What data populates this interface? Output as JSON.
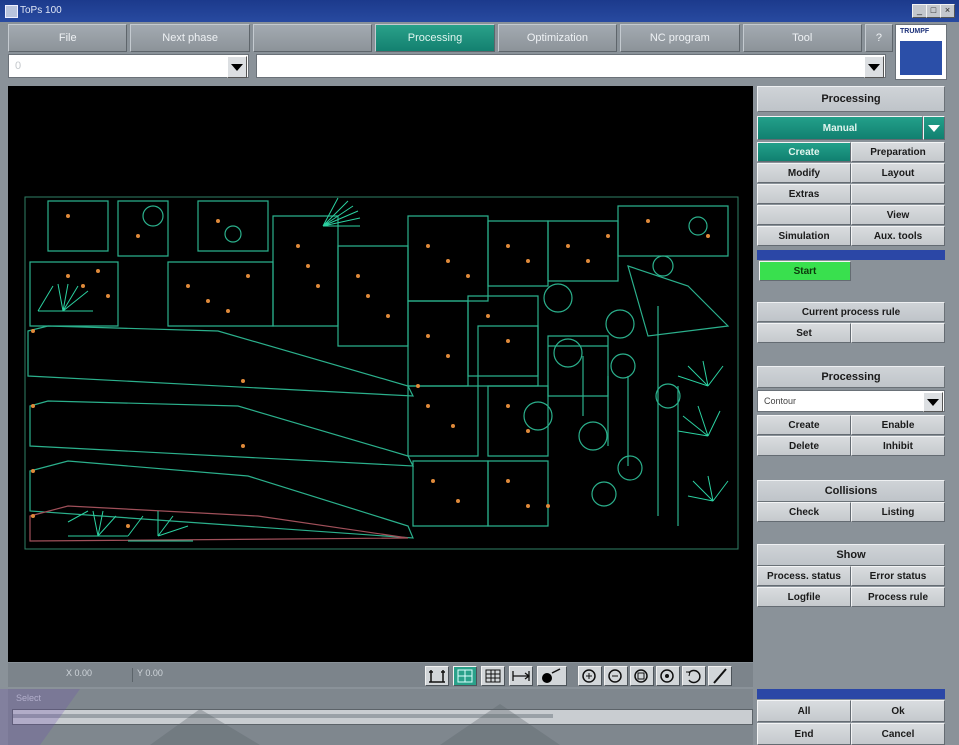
{
  "window": {
    "title": "ToPs 100"
  },
  "menu": {
    "items": [
      "File",
      "Next phase",
      "",
      "Processing",
      "Optimization",
      "NC program",
      "Tool"
    ],
    "active": "Processing",
    "extra": "?"
  },
  "logo": {
    "text": "TRUMPF"
  },
  "combos": {
    "left_value": "0",
    "right_value": ""
  },
  "panel": {
    "title": "Processing",
    "mode_value": "Manual",
    "grid": [
      [
        "Create",
        "Preparation"
      ],
      [
        "Modify",
        "Layout"
      ],
      [
        "Extras",
        ""
      ],
      [
        "",
        "View"
      ],
      [
        "Simulation",
        "Aux. tools"
      ]
    ],
    "start": "Start",
    "current_rule": {
      "header": "Current process rule",
      "set": "Set"
    },
    "processing": {
      "header": "Processing",
      "select_value": "Contour",
      "buttons": [
        "Create",
        "Enable",
        "Delete",
        "Inhibit"
      ]
    },
    "collisions": {
      "header": "Collisions",
      "buttons": [
        "Check",
        "Listing"
      ]
    },
    "show": {
      "header": "Show",
      "buttons": [
        "Process. status",
        "Error status",
        "Logfile",
        "Process rule"
      ]
    },
    "bottom": {
      "buttons": [
        "All",
        "Ok",
        "End",
        "Cancel"
      ]
    }
  },
  "status": {
    "x": "X 0.00",
    "y": "Y 0.00",
    "message": "Select"
  },
  "colors": {
    "accent": "#138070",
    "highlight": "#39e04e",
    "canvas": "#000000",
    "contour_green": "#2bb08c",
    "marker_orange": "#e08a3a",
    "title_blue": "#2b47a6"
  }
}
